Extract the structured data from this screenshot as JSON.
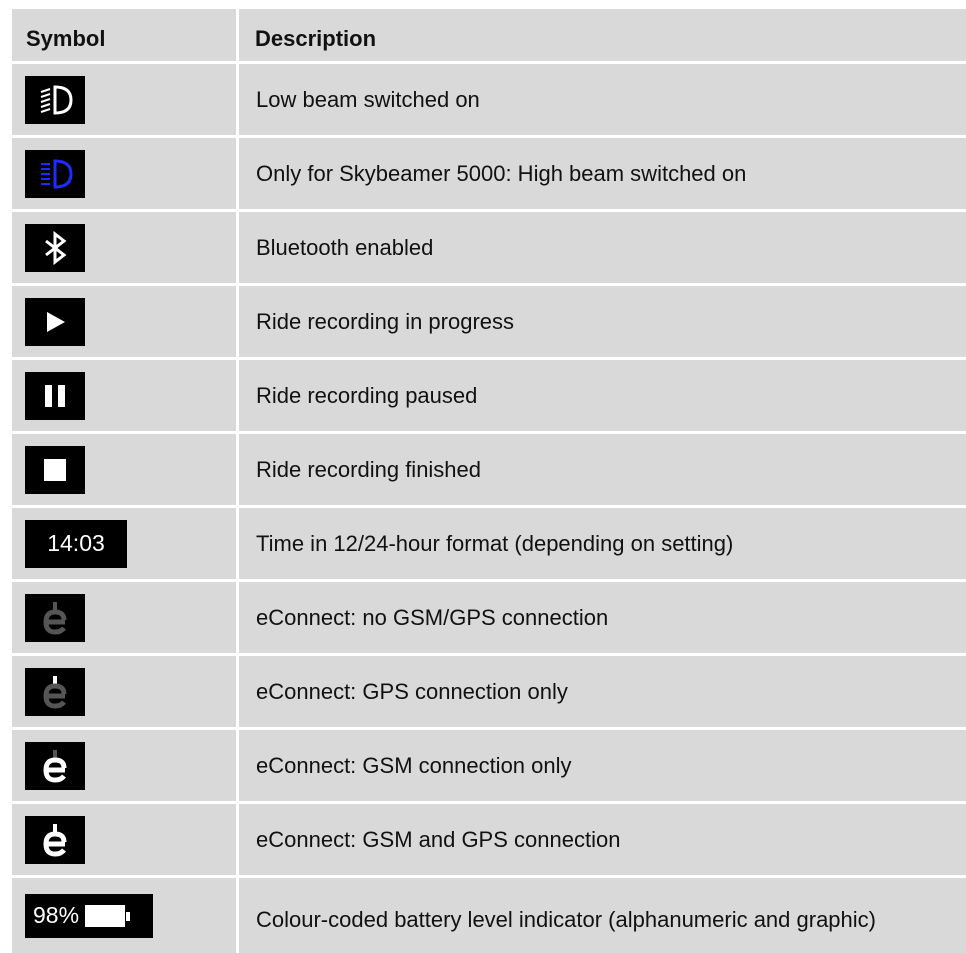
{
  "table": {
    "header": {
      "symbol": "Symbol",
      "description": "Description"
    },
    "rows": [
      {
        "icon": "low-beam-icon",
        "description": "Low beam switched on"
      },
      {
        "icon": "high-beam-icon",
        "description": "Only for Skybeamer 5000: High beam switched on"
      },
      {
        "icon": "bluetooth-icon",
        "description": "Bluetooth enabled"
      },
      {
        "icon": "play-icon",
        "description": "Ride recording in progress"
      },
      {
        "icon": "pause-icon",
        "description": "Ride recording paused"
      },
      {
        "icon": "stop-icon",
        "description": "Ride recording finished"
      },
      {
        "icon": "clock-display",
        "symbol_text": "14:03",
        "description": "Time in 12/24-hour format (depending on setting)"
      },
      {
        "icon": "econnect-none-icon",
        "description": "eConnect: no GSM/GPS connection"
      },
      {
        "icon": "econnect-gps-icon",
        "description": "eConnect: GPS connection only"
      },
      {
        "icon": "econnect-gsm-icon",
        "description": "eConnect: GSM connection only"
      },
      {
        "icon": "econnect-gsm-gps-icon",
        "description": "eConnect: GSM and GPS connection"
      },
      {
        "icon": "battery-indicator",
        "symbol_text": "98%",
        "battery_level_percent": 98,
        "description": "Colour-coded battery level indicator (alphanumeric and graphic)"
      }
    ]
  },
  "colors": {
    "cell_background": "#d9d9d9",
    "icon_background": "#000000",
    "high_beam_blue": "#1f2bff",
    "econnect_dim": "#555555"
  }
}
